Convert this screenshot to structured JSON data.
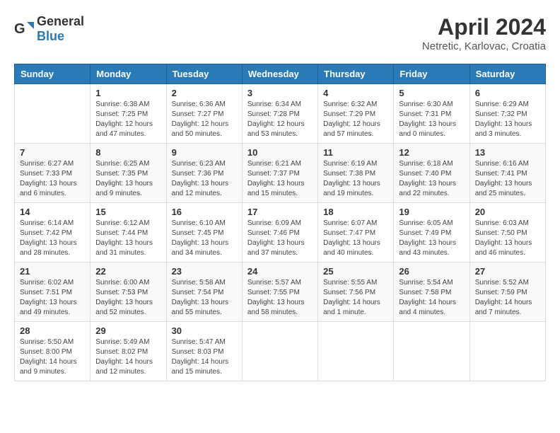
{
  "header": {
    "logo_general": "General",
    "logo_blue": "Blue",
    "month_year": "April 2024",
    "location": "Netretic, Karlovac, Croatia"
  },
  "days_of_week": [
    "Sunday",
    "Monday",
    "Tuesday",
    "Wednesday",
    "Thursday",
    "Friday",
    "Saturday"
  ],
  "weeks": [
    [
      {
        "day": "",
        "info": ""
      },
      {
        "day": "1",
        "info": "Sunrise: 6:38 AM\nSunset: 7:25 PM\nDaylight: 12 hours\nand 47 minutes."
      },
      {
        "day": "2",
        "info": "Sunrise: 6:36 AM\nSunset: 7:27 PM\nDaylight: 12 hours\nand 50 minutes."
      },
      {
        "day": "3",
        "info": "Sunrise: 6:34 AM\nSunset: 7:28 PM\nDaylight: 12 hours\nand 53 minutes."
      },
      {
        "day": "4",
        "info": "Sunrise: 6:32 AM\nSunset: 7:29 PM\nDaylight: 12 hours\nand 57 minutes."
      },
      {
        "day": "5",
        "info": "Sunrise: 6:30 AM\nSunset: 7:31 PM\nDaylight: 13 hours\nand 0 minutes."
      },
      {
        "day": "6",
        "info": "Sunrise: 6:29 AM\nSunset: 7:32 PM\nDaylight: 13 hours\nand 3 minutes."
      }
    ],
    [
      {
        "day": "7",
        "info": "Sunrise: 6:27 AM\nSunset: 7:33 PM\nDaylight: 13 hours\nand 6 minutes."
      },
      {
        "day": "8",
        "info": "Sunrise: 6:25 AM\nSunset: 7:35 PM\nDaylight: 13 hours\nand 9 minutes."
      },
      {
        "day": "9",
        "info": "Sunrise: 6:23 AM\nSunset: 7:36 PM\nDaylight: 13 hours\nand 12 minutes."
      },
      {
        "day": "10",
        "info": "Sunrise: 6:21 AM\nSunset: 7:37 PM\nDaylight: 13 hours\nand 15 minutes."
      },
      {
        "day": "11",
        "info": "Sunrise: 6:19 AM\nSunset: 7:38 PM\nDaylight: 13 hours\nand 19 minutes."
      },
      {
        "day": "12",
        "info": "Sunrise: 6:18 AM\nSunset: 7:40 PM\nDaylight: 13 hours\nand 22 minutes."
      },
      {
        "day": "13",
        "info": "Sunrise: 6:16 AM\nSunset: 7:41 PM\nDaylight: 13 hours\nand 25 minutes."
      }
    ],
    [
      {
        "day": "14",
        "info": "Sunrise: 6:14 AM\nSunset: 7:42 PM\nDaylight: 13 hours\nand 28 minutes."
      },
      {
        "day": "15",
        "info": "Sunrise: 6:12 AM\nSunset: 7:44 PM\nDaylight: 13 hours\nand 31 minutes."
      },
      {
        "day": "16",
        "info": "Sunrise: 6:10 AM\nSunset: 7:45 PM\nDaylight: 13 hours\nand 34 minutes."
      },
      {
        "day": "17",
        "info": "Sunrise: 6:09 AM\nSunset: 7:46 PM\nDaylight: 13 hours\nand 37 minutes."
      },
      {
        "day": "18",
        "info": "Sunrise: 6:07 AM\nSunset: 7:47 PM\nDaylight: 13 hours\nand 40 minutes."
      },
      {
        "day": "19",
        "info": "Sunrise: 6:05 AM\nSunset: 7:49 PM\nDaylight: 13 hours\nand 43 minutes."
      },
      {
        "day": "20",
        "info": "Sunrise: 6:03 AM\nSunset: 7:50 PM\nDaylight: 13 hours\nand 46 minutes."
      }
    ],
    [
      {
        "day": "21",
        "info": "Sunrise: 6:02 AM\nSunset: 7:51 PM\nDaylight: 13 hours\nand 49 minutes."
      },
      {
        "day": "22",
        "info": "Sunrise: 6:00 AM\nSunset: 7:53 PM\nDaylight: 13 hours\nand 52 minutes."
      },
      {
        "day": "23",
        "info": "Sunrise: 5:58 AM\nSunset: 7:54 PM\nDaylight: 13 hours\nand 55 minutes."
      },
      {
        "day": "24",
        "info": "Sunrise: 5:57 AM\nSunset: 7:55 PM\nDaylight: 13 hours\nand 58 minutes."
      },
      {
        "day": "25",
        "info": "Sunrise: 5:55 AM\nSunset: 7:56 PM\nDaylight: 14 hours\nand 1 minute."
      },
      {
        "day": "26",
        "info": "Sunrise: 5:54 AM\nSunset: 7:58 PM\nDaylight: 14 hours\nand 4 minutes."
      },
      {
        "day": "27",
        "info": "Sunrise: 5:52 AM\nSunset: 7:59 PM\nDaylight: 14 hours\nand 7 minutes."
      }
    ],
    [
      {
        "day": "28",
        "info": "Sunrise: 5:50 AM\nSunset: 8:00 PM\nDaylight: 14 hours\nand 9 minutes."
      },
      {
        "day": "29",
        "info": "Sunrise: 5:49 AM\nSunset: 8:02 PM\nDaylight: 14 hours\nand 12 minutes."
      },
      {
        "day": "30",
        "info": "Sunrise: 5:47 AM\nSunset: 8:03 PM\nDaylight: 14 hours\nand 15 minutes."
      },
      {
        "day": "",
        "info": ""
      },
      {
        "day": "",
        "info": ""
      },
      {
        "day": "",
        "info": ""
      },
      {
        "day": "",
        "info": ""
      }
    ]
  ]
}
